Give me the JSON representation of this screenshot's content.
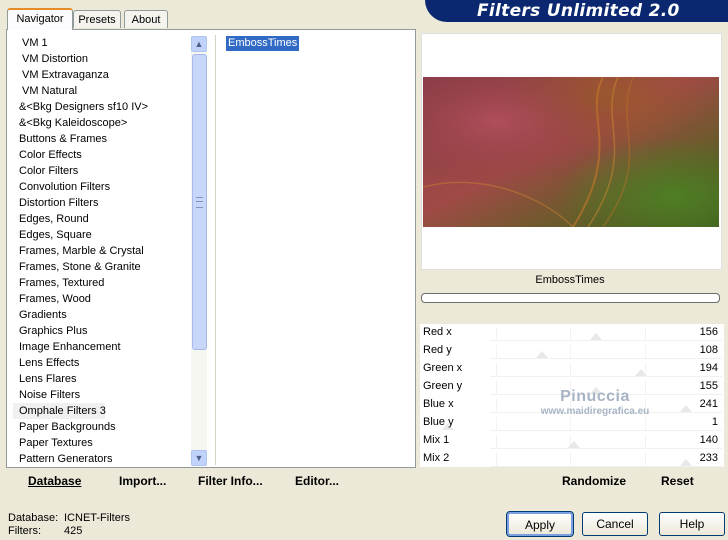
{
  "window": {
    "logo_text": "Filters Unlimited 2.0"
  },
  "tabs": [
    {
      "label": "Navigator",
      "active": true
    },
    {
      "label": "Presets",
      "active": false
    },
    {
      "label": "About",
      "active": false
    }
  ],
  "categories": [
    "VM 1",
    "VM Distortion",
    "VM Extravaganza",
    "VM Natural",
    "&<Bkg Designers sf10 IV>",
    "&<Bkg Kaleidoscope>",
    "Buttons & Frames",
    "Color Effects",
    "Color Filters",
    "Convolution Filters",
    "Distortion Filters",
    "Edges, Round",
    "Edges, Square",
    "Frames, Marble & Crystal",
    "Frames, Stone & Granite",
    "Frames, Textured",
    "Frames, Wood",
    "Gradients",
    "Graphics Plus",
    "Image Enhancement",
    "Lens Effects",
    "Lens Flares",
    "Noise Filters",
    "Omphale Filters 3",
    "Paper Backgrounds",
    "Paper Textures",
    "Pattern Generators"
  ],
  "selected_category": "Omphale Filters 3",
  "filters": [
    "EmbossTimes"
  ],
  "selected_filter": "EmbossTimes",
  "left_buttons": {
    "database": "Database",
    "import": "Import...",
    "filter_info": "Filter Info...",
    "editor": "Editor..."
  },
  "preview": {
    "filter_name": "EmbossTimes"
  },
  "params": [
    {
      "label": "Red x",
      "value": 156
    },
    {
      "label": "Red y",
      "value": 108
    },
    {
      "label": "Green x",
      "value": 194
    },
    {
      "label": "Green y",
      "value": 155
    },
    {
      "label": "Blue x",
      "value": 241
    },
    {
      "label": "Blue y",
      "value": 1
    },
    {
      "label": "Mix 1",
      "value": 140
    },
    {
      "label": "Mix 2",
      "value": 233
    }
  ],
  "watermark": {
    "line1": "Pinuccia",
    "line2": "www.maidiregrafica.eu"
  },
  "right_buttons": {
    "randomize": "Randomize",
    "reset": "Reset"
  },
  "status": {
    "database_label": "Database:",
    "database_value": "ICNET-Filters",
    "filters_label": "Filters:",
    "filters_value": "425"
  },
  "dialog_buttons": {
    "apply": "Apply",
    "cancel": "Cancel",
    "help": "Help"
  }
}
